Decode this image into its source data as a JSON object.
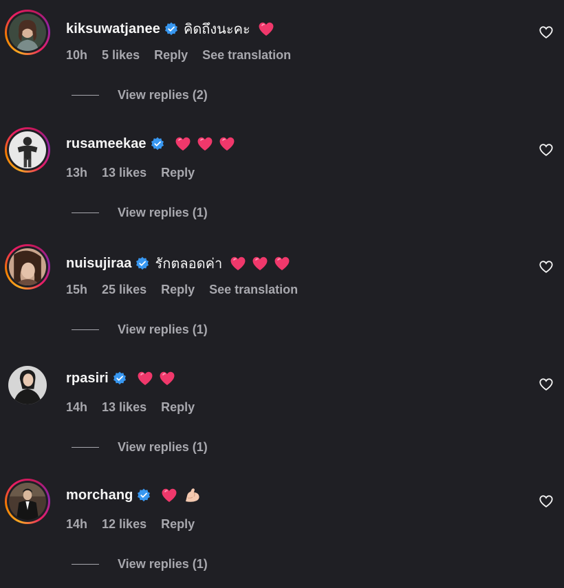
{
  "colors": {
    "background": "#1f1f24",
    "text": "#f5f5f5",
    "muted": "#a8a8ae",
    "verified": "#3897f0",
    "heart_emoji": "#f0386b"
  },
  "comments": [
    {
      "username": "kiksuwatjanee",
      "text": "คิดถึงนะคะ",
      "emojis": [
        "heart"
      ],
      "time": "10h",
      "likes": "5 likes",
      "reply": "Reply",
      "translation": "See translation",
      "view_replies": "View replies (2)",
      "story_ring": true,
      "avatar_icon": "avatar-kiksuwatjanee"
    },
    {
      "username": "rusameekae",
      "text": "",
      "emojis": [
        "heart",
        "heart",
        "heart"
      ],
      "time": "13h",
      "likes": "13 likes",
      "reply": "Reply",
      "translation": "",
      "view_replies": "View replies (1)",
      "story_ring": true,
      "avatar_icon": "avatar-rusameekae"
    },
    {
      "username": "nuisujiraa",
      "text": "รักตลอดค่า",
      "emojis": [
        "heart",
        "heart",
        "heart"
      ],
      "time": "15h",
      "likes": "25 likes",
      "reply": "Reply",
      "translation": "See translation",
      "view_replies": "View replies (1)",
      "story_ring": true,
      "avatar_icon": "avatar-nuisujiraa"
    },
    {
      "username": "rpasiri",
      "text": "",
      "emojis": [
        "heart",
        "heart"
      ],
      "time": "14h",
      "likes": "13 likes",
      "reply": "Reply",
      "translation": "",
      "view_replies": "View replies (1)",
      "story_ring": false,
      "avatar_icon": "avatar-rpasiri"
    },
    {
      "username": "morchang",
      "text": "",
      "emojis": [
        "heart",
        "flexed-biceps"
      ],
      "time": "14h",
      "likes": "12 likes",
      "reply": "Reply",
      "translation": "",
      "view_replies": "View replies (1)",
      "story_ring": true,
      "avatar_icon": "avatar-morchang"
    }
  ]
}
